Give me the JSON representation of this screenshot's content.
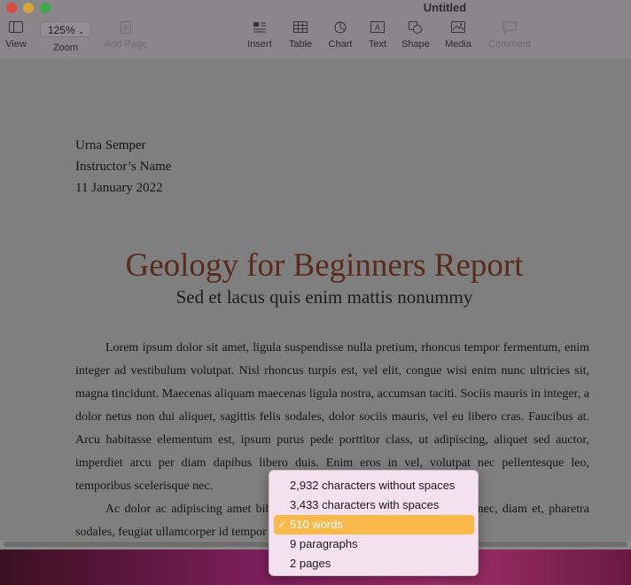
{
  "window": {
    "title": "Untitled"
  },
  "toolbar": {
    "view_label": "View",
    "zoom_value": "125%",
    "zoom_label": "Zoom",
    "add_page_label": "Add Page",
    "insert_label": "Insert",
    "table_label": "Table",
    "chart_label": "Chart",
    "text_label": "Text",
    "shape_label": "Shape",
    "media_label": "Media",
    "comment_label": "Comment"
  },
  "document": {
    "author": "Urna Semper",
    "instructor": "Instructor’s Name",
    "date": "11 January 2022",
    "title": "Geology for Beginners Report",
    "subtitle": "Sed et lacus quis enim mattis nonummy",
    "paragraph1": "Lorem ipsum dolor sit amet, ligula suspendisse nulla pretium, rhoncus tempor fermentum, enim integer ad vestibulum volutpat. Nisl rhoncus turpis est, vel elit, congue wisi enim nunc ultricies sit, magna tincidunt. Maecenas aliquam maecenas ligula nostra, accumsan taciti. Sociis mauris in integer, a dolor netus non dui aliquet, sagittis felis sodales, dolor sociis mauris, vel eu libero cras. Faucibus at. Arcu habitasse elementum est, ipsum purus pede porttitor class, ut adipiscing, aliquet sed auctor, imperdiet arcu per diam dapibus libero duis. Enim eros in vel, volutpat nec pellentesque leo, temporibus scelerisque nec.",
    "paragraph2": "Ac dolor ac adipiscing amet bibendum nullam, lacus molestie ut libero nec, diam et, pharetra sodales, feugiat ullamcorper id tempor id vitae. Mauris pretium aliquet, lectus"
  },
  "word_count_menu": {
    "items": [
      "2,932 characters without spaces",
      "3,433 characters with spaces",
      "510 words",
      "9 paragraphs",
      "2 pages"
    ],
    "selected_index": 2
  },
  "colors": {
    "title_color": "#5a2a1a",
    "selection": "#f9b84a",
    "menu_background": "#f4e1f0"
  }
}
